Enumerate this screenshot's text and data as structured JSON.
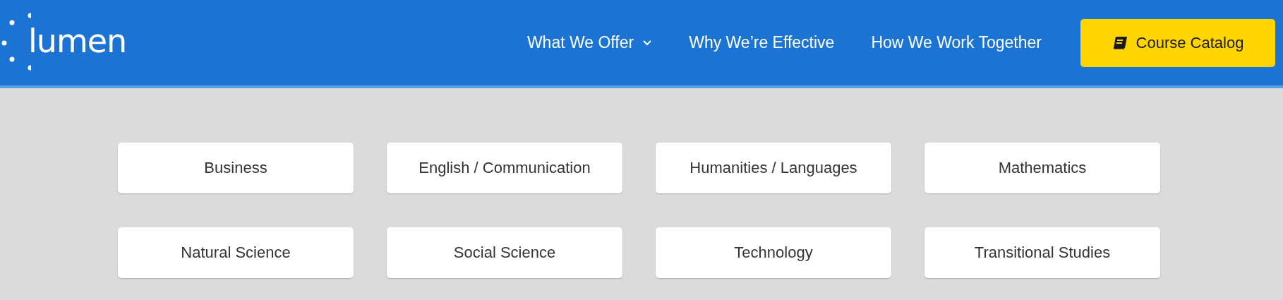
{
  "logo": "lumen",
  "nav": [
    {
      "label": "What We Offer",
      "kind": "dropdown"
    },
    {
      "label": "Why We’re Effective",
      "kind": "link"
    },
    {
      "label": "How We Work Together",
      "kind": "link"
    }
  ],
  "cta": {
    "label": "Course Catalog"
  },
  "subjects": [
    "Business",
    "English / Communication",
    "Humanities / Languages",
    "Mathematics",
    "Natural Science",
    "Social Science",
    "Technology",
    "Transitional Studies"
  ]
}
